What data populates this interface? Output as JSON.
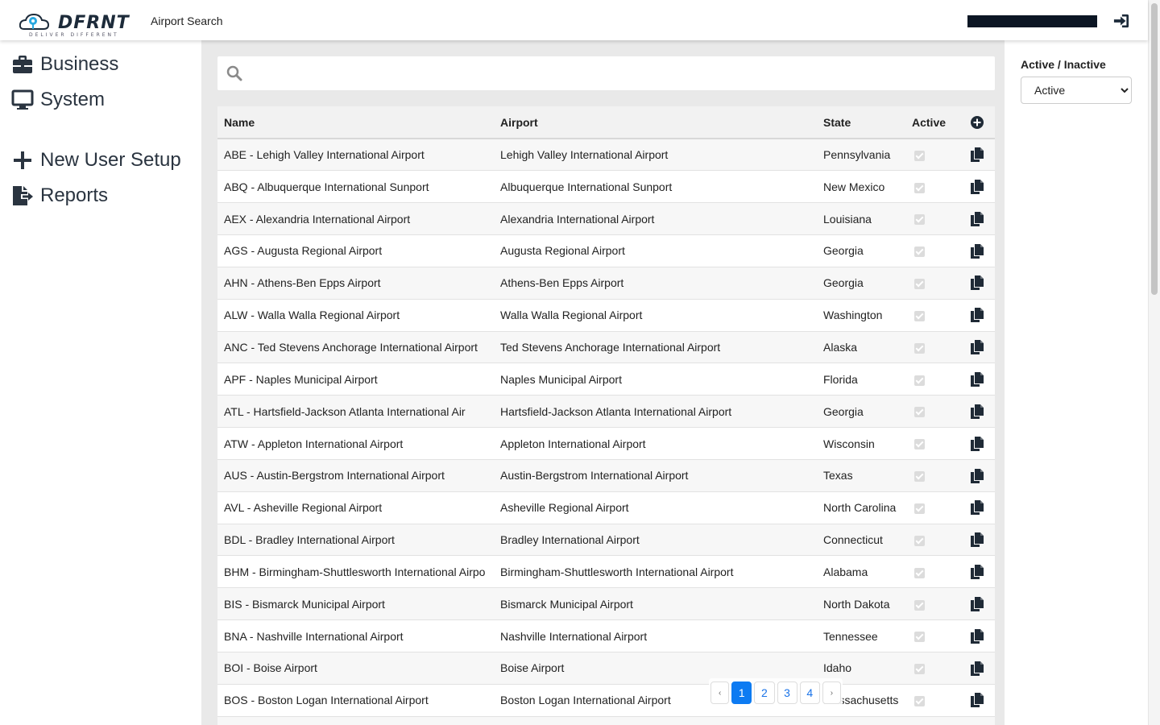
{
  "header": {
    "logo_text": "DFRNT",
    "logo_tagline": "DELIVER DIFFERENT",
    "page_title": "Airport Search"
  },
  "sidebar": {
    "items": [
      {
        "label": "Business",
        "icon": "briefcase-icon"
      },
      {
        "label": "System",
        "icon": "monitor-icon"
      },
      {
        "label": "New User Setup",
        "icon": "plus-icon"
      },
      {
        "label": "Reports",
        "icon": "file-export-icon"
      }
    ]
  },
  "search": {
    "placeholder": ""
  },
  "table": {
    "headers": {
      "name": "Name",
      "airport": "Airport",
      "state": "State",
      "active": "Active"
    },
    "rows": [
      {
        "name": "ABE - Lehigh Valley International Airport",
        "airport": "Lehigh Valley International Airport",
        "state": "Pennsylvania",
        "active": true
      },
      {
        "name": "ABQ - Albuquerque International Sunport",
        "airport": "Albuquerque International Sunport",
        "state": "New Mexico",
        "active": true
      },
      {
        "name": "AEX - Alexandria International Airport",
        "airport": "Alexandria International Airport",
        "state": "Louisiana",
        "active": true
      },
      {
        "name": "AGS - Augusta Regional Airport",
        "airport": "Augusta Regional Airport",
        "state": "Georgia",
        "active": true
      },
      {
        "name": "AHN - Athens-Ben Epps Airport",
        "airport": "Athens-Ben Epps Airport",
        "state": "Georgia",
        "active": true
      },
      {
        "name": "ALW - Walla Walla Regional Airport",
        "airport": "Walla Walla Regional Airport",
        "state": "Washington",
        "active": true
      },
      {
        "name": "ANC - Ted Stevens Anchorage International Airport",
        "airport": "Ted Stevens Anchorage International Airport",
        "state": "Alaska",
        "active": true
      },
      {
        "name": "APF - Naples Municipal Airport",
        "airport": "Naples Municipal Airport",
        "state": "Florida",
        "active": true
      },
      {
        "name": "ATL - Hartsfield-Jackson Atlanta International Air",
        "airport": "Hartsfield-Jackson Atlanta International Airport",
        "state": "Georgia",
        "active": true
      },
      {
        "name": "ATW - Appleton International Airport",
        "airport": "Appleton International Airport",
        "state": "Wisconsin",
        "active": true
      },
      {
        "name": "AUS - Austin-Bergstrom International Airport",
        "airport": "Austin-Bergstrom International Airport",
        "state": "Texas",
        "active": true
      },
      {
        "name": "AVL - Asheville Regional Airport",
        "airport": "Asheville Regional Airport",
        "state": "North Carolina",
        "active": true
      },
      {
        "name": "BDL - Bradley International Airport",
        "airport": "Bradley International Airport",
        "state": "Connecticut",
        "active": true
      },
      {
        "name": "BHM - Birmingham-Shuttlesworth International Airpo",
        "airport": "Birmingham-Shuttlesworth International Airport",
        "state": "Alabama",
        "active": true
      },
      {
        "name": "BIS - Bismarck Municipal Airport",
        "airport": "Bismarck Municipal Airport",
        "state": "North Dakota",
        "active": true
      },
      {
        "name": "BNA - Nashville International Airport",
        "airport": "Nashville International Airport",
        "state": "Tennessee",
        "active": true
      },
      {
        "name": "BOI - Boise Airport",
        "airport": "Boise Airport",
        "state": "Idaho",
        "active": true
      },
      {
        "name": "BOS - Boston Logan International Airport",
        "airport": "Boston Logan International Airport",
        "state": "Massachusetts",
        "active": true
      },
      {
        "name": "",
        "airport": "",
        "state": "",
        "active": true
      }
    ]
  },
  "pagination": {
    "prev": "‹",
    "pages": [
      "1",
      "2",
      "3",
      "4"
    ],
    "current": "1",
    "next": "›"
  },
  "filter": {
    "label": "Active / Inactive",
    "selected": "Active",
    "options": [
      "Active"
    ]
  },
  "colors": {
    "accent": "#0d7bf2",
    "user_bar": "#0c1624"
  }
}
